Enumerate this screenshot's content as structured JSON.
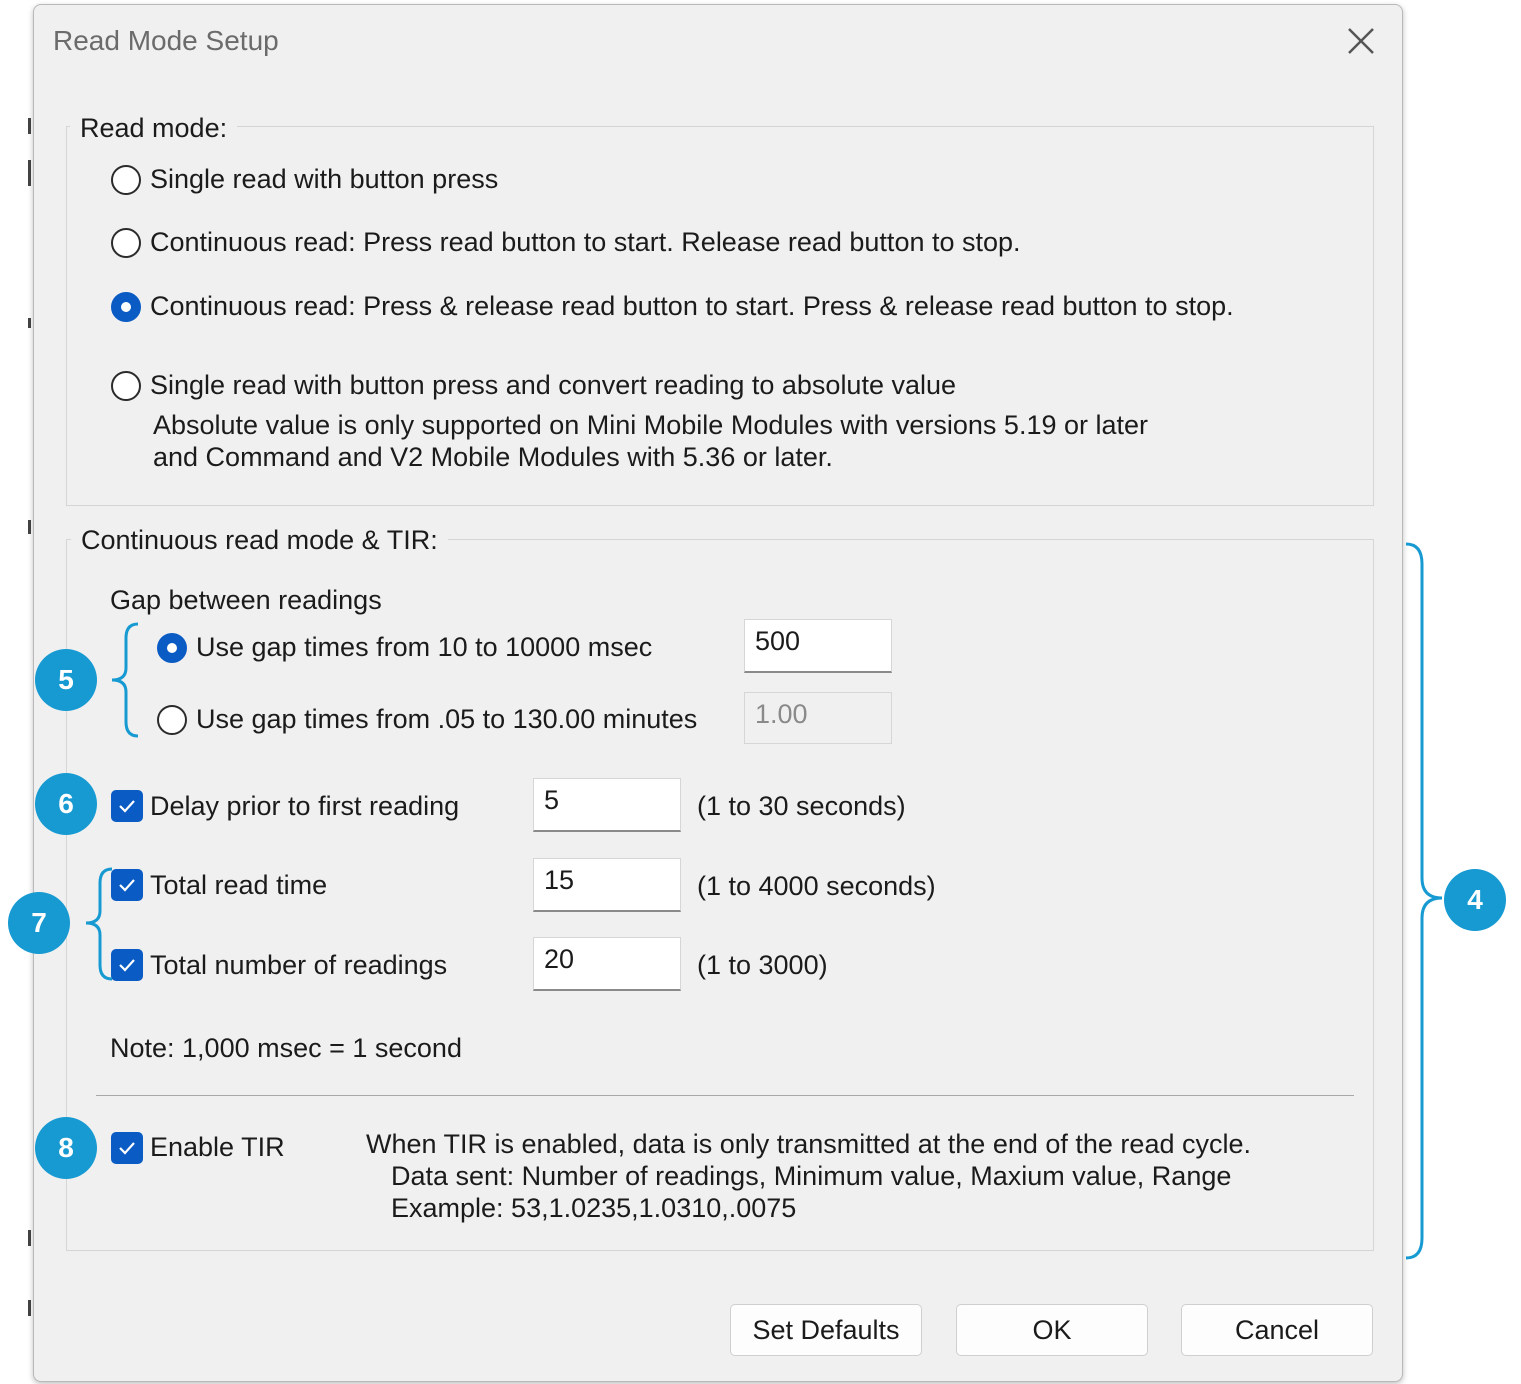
{
  "window": {
    "title": "Read Mode Setup"
  },
  "read_mode": {
    "group_label": "Read mode:",
    "options": [
      {
        "label": "Single read with button press",
        "selected": false
      },
      {
        "label": "Continuous read:  Press read button to start.  Release read button to stop.",
        "selected": false
      },
      {
        "label": "Continuous read:  Press & release read button to start.  Press & release read button to stop.",
        "selected": true
      },
      {
        "label": "Single read with button press and convert reading to absolute value",
        "selected": false
      }
    ],
    "absolute_note_line1": "Absolute value is only supported on Mini Mobile Modules with versions 5.19 or later",
    "absolute_note_line2": "and Command and V2 Mobile Modules with 5.36 or later."
  },
  "continuous": {
    "group_label": "Continuous read mode & TIR:",
    "gap_heading": "Gap between readings",
    "gap_options": [
      {
        "label": "Use gap times from 10 to 10000 msec",
        "value": "500",
        "selected": true,
        "enabled": true
      },
      {
        "label": "Use gap times from .05 to 130.00 minutes",
        "value": "1.00",
        "selected": false,
        "enabled": false
      }
    ],
    "delay": {
      "label": "Delay prior to first reading",
      "value": "5",
      "range": "(1 to 30 seconds)",
      "checked": true
    },
    "total_time": {
      "label": "Total read time",
      "value": "15",
      "range": "(1 to 4000 seconds)",
      "checked": true
    },
    "total_readings": {
      "label": "Total number of readings",
      "value": "20",
      "range": "(1 to 3000)",
      "checked": true
    },
    "note": "Note: 1,000 msec = 1 second",
    "tir": {
      "label": "Enable TIR",
      "checked": true,
      "desc_line1": "When TIR is enabled, data is only transmitted at the end of the read cycle.",
      "desc_line2": "Data sent: Number of readings, Minimum value, Maxium value, Range",
      "desc_line3": "Example: 53,1.0235,1.0310,.0075"
    }
  },
  "buttons": {
    "set_defaults": "Set Defaults",
    "ok": "OK",
    "cancel": "Cancel"
  },
  "callouts": {
    "c4": "4",
    "c5": "5",
    "c6": "6",
    "c7": "7",
    "c8": "8",
    "color": "#179ad2"
  },
  "colors": {
    "accent": "#0a5bc4",
    "dialog_bg": "#f0f0f0"
  }
}
